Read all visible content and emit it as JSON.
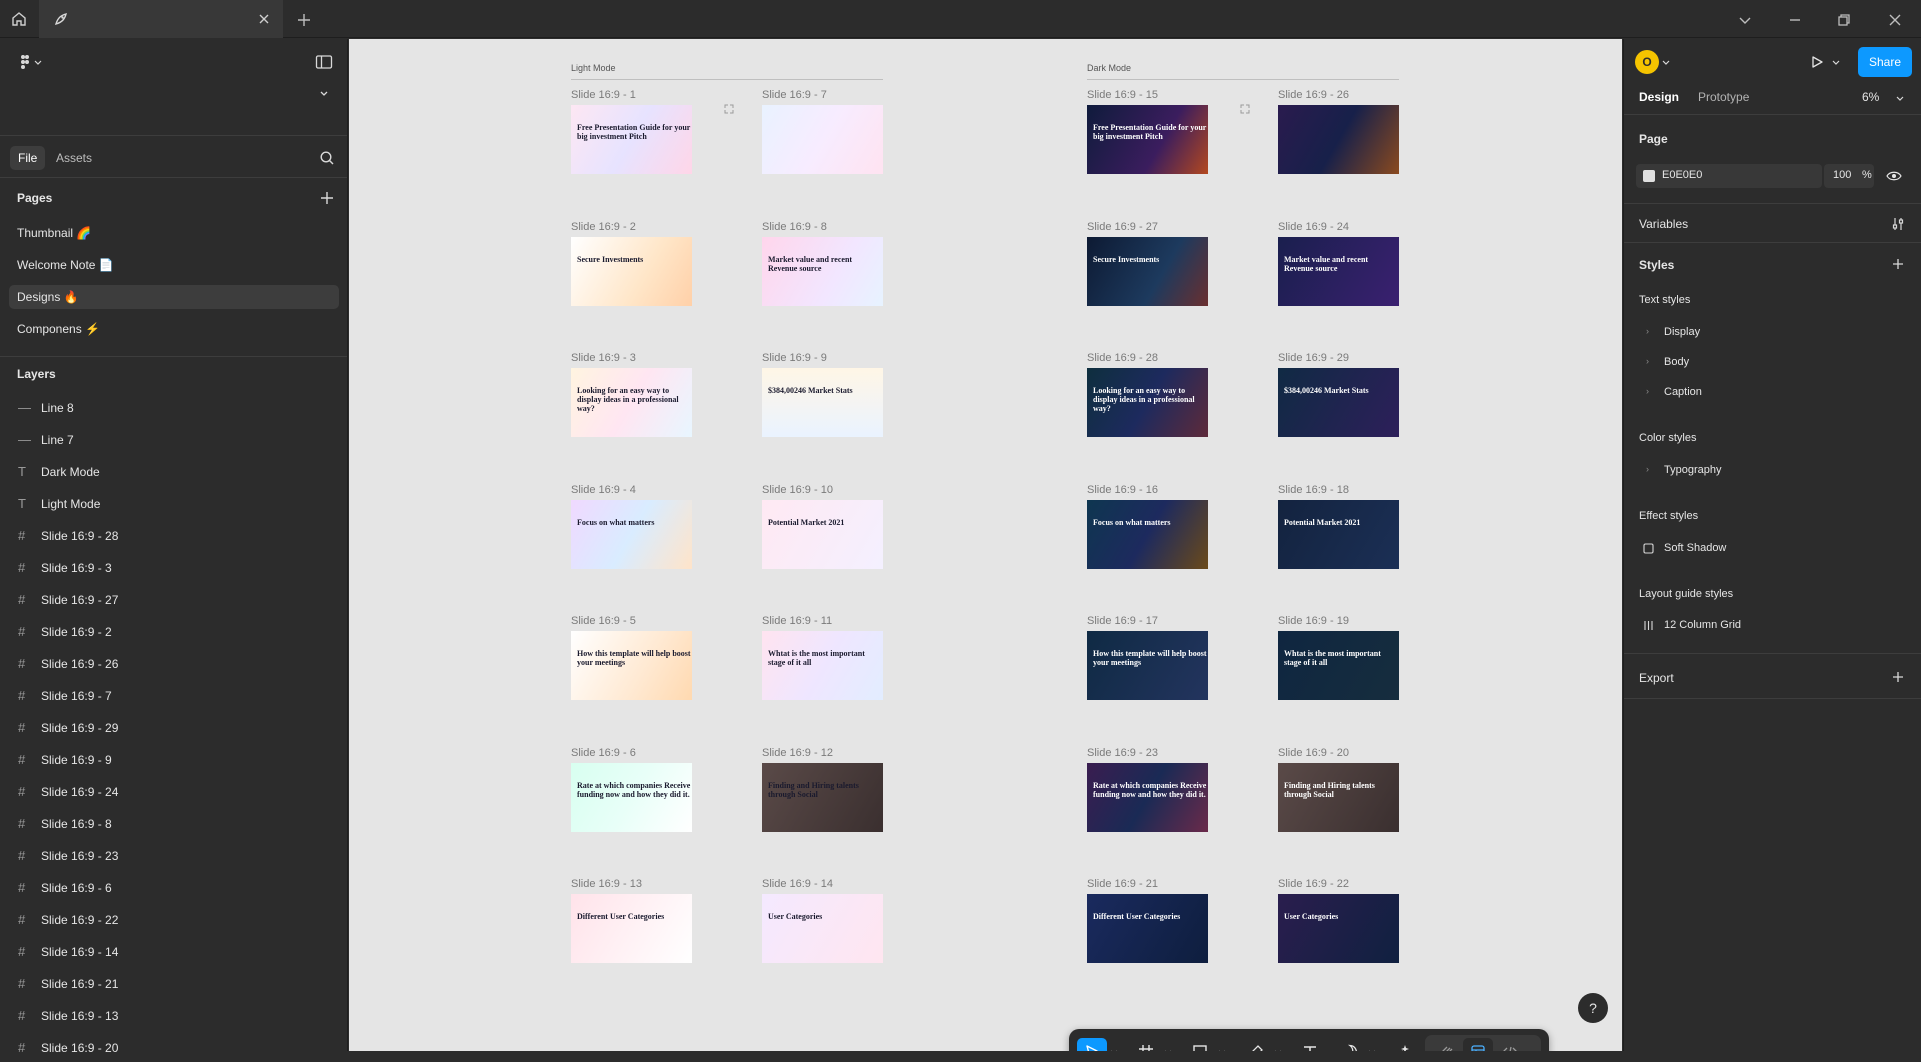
{
  "titlebar": {
    "tab_title": ""
  },
  "left": {
    "file_tab": "File",
    "assets_tab": "Assets",
    "pages_heading": "Pages",
    "pages": [
      {
        "label": "Thumbnail 🌈"
      },
      {
        "label": "Welcome Note 📄"
      },
      {
        "label": "Designs 🔥"
      },
      {
        "label": "Componens ⚡"
      }
    ],
    "layers_heading": "Layers",
    "layers": [
      {
        "label": "Line 8",
        "type": "line"
      },
      {
        "label": "Line 7",
        "type": "line"
      },
      {
        "label": "Dark Mode",
        "type": "text"
      },
      {
        "label": "Light Mode",
        "type": "text"
      },
      {
        "label": "Slide 16:9 - 28",
        "type": "frame"
      },
      {
        "label": "Slide 16:9 - 3",
        "type": "frame"
      },
      {
        "label": "Slide 16:9 - 27",
        "type": "frame"
      },
      {
        "label": "Slide 16:9 - 2",
        "type": "frame"
      },
      {
        "label": "Slide 16:9 - 26",
        "type": "frame"
      },
      {
        "label": "Slide 16:9 - 7",
        "type": "frame"
      },
      {
        "label": "Slide 16:9 - 29",
        "type": "frame"
      },
      {
        "label": "Slide 16:9 - 9",
        "type": "frame"
      },
      {
        "label": "Slide 16:9 - 24",
        "type": "frame"
      },
      {
        "label": "Slide 16:9 - 8",
        "type": "frame"
      },
      {
        "label": "Slide 16:9 - 23",
        "type": "frame"
      },
      {
        "label": "Slide 16:9 - 6",
        "type": "frame"
      },
      {
        "label": "Slide 16:9 - 22",
        "type": "frame"
      },
      {
        "label": "Slide 16:9 - 14",
        "type": "frame"
      },
      {
        "label": "Slide 16:9 - 21",
        "type": "frame"
      },
      {
        "label": "Slide 16:9 - 13",
        "type": "frame"
      },
      {
        "label": "Slide 16:9 - 20",
        "type": "frame"
      }
    ]
  },
  "canvas": {
    "light_heading": "Light Mode",
    "dark_heading": "Dark Mode",
    "light_slides": [
      {
        "label": "Slide 16:9 - 1",
        "title": "Free Presentation Guide for your big investment Pitch",
        "bg": "linear-gradient(120deg,#fde7f3,#e7e3ff 50%,#ffd6e8)"
      },
      {
        "label": "Slide 16:9 - 7",
        "title": "",
        "bg": "linear-gradient(120deg,#e9f2ff,#f7ecff 50%,#ffe3f1)"
      },
      {
        "label": "Slide 16:9 - 2",
        "title": "Secure Investments",
        "bg": "linear-gradient(120deg,#fff,#ffe6c8 60%,#ffd0a8)"
      },
      {
        "label": "Slide 16:9 - 8",
        "title": "Market value and recent Revenue source",
        "bg": "linear-gradient(120deg,#ffd6ec,#f2e6ff 60%,#e7f3ff)"
      },
      {
        "label": "Slide 16:9 - 3",
        "title": "Looking for an easy way to display ideas in a professional way?",
        "bg": "linear-gradient(120deg,#fff4e0,#ffe6f2 50%,#e8f6ff)"
      },
      {
        "label": "Slide 16:9 - 9",
        "title": "$384,00246   Market Stats",
        "bg": "linear-gradient(180deg,#fff6e6,#eaf3ff)"
      },
      {
        "label": "Slide 16:9 - 4",
        "title": "Focus on what matters",
        "bg": "linear-gradient(120deg,#f0d9ff,#d9ecff 50%,#ffe4c9)"
      },
      {
        "label": "Slide 16:9 - 10",
        "title": "Potential Market 2021",
        "bg": "linear-gradient(120deg,#ffe9f3,#f4f0ff)"
      },
      {
        "label": "Slide 16:9 - 5",
        "title": "How this template will help boost your meetings",
        "bg": "linear-gradient(120deg,#fff,#ffe9d2 60%,#ffd9b0)"
      },
      {
        "label": "Slide 16:9 - 11",
        "title": "Whtat is the most important stage of it all",
        "bg": "linear-gradient(120deg,#ffe4f0,#efe6ff 50%,#e2edff)"
      },
      {
        "label": "Slide 16:9 - 6",
        "title": "Rate at which companies Receive funding now and how they did it.",
        "bg": "linear-gradient(120deg,#d8fff0,#e8fff8 50%,#fff)"
      },
      {
        "label": "Slide 16:9 - 12",
        "title": "Finding and Hiring talents through Social",
        "bg": "linear-gradient(120deg,#5a4a48,#3a2f2f)"
      },
      {
        "label": "Slide 16:9 - 13",
        "title": "Different User Categories",
        "bg": "linear-gradient(120deg,#ffe3ea,#fff)"
      },
      {
        "label": "Slide 16:9 - 14",
        "title": "User Categories",
        "bg": "linear-gradient(120deg,#f4e9ff,#ffe6f0)"
      }
    ],
    "dark_slides": [
      {
        "label": "Slide 16:9 - 15",
        "title": "Free Presentation Guide for your big investment Pitch",
        "bg": "linear-gradient(120deg,#0f1b3c,#3b1d5e 60%,#b3481f)"
      },
      {
        "label": "Slide 16:9 - 26",
        "title": "",
        "bg": "linear-gradient(120deg,#2a1b4e,#17204a 50%,#8a4a1f)"
      },
      {
        "label": "Slide 16:9 - 27",
        "title": "Secure Investments",
        "bg": "linear-gradient(120deg,#0d1a33,#1d3a5e 60%,#6a2f2f)"
      },
      {
        "label": "Slide 16:9 - 24",
        "title": "Market value and recent Revenue source",
        "bg": "linear-gradient(120deg,#1a1f4e,#3a2070)"
      },
      {
        "label": "Slide 16:9 - 28",
        "title": "Looking for an easy way to display ideas in a professional way?",
        "bg": "linear-gradient(120deg,#0e2f3e,#1d2a5e 50%,#5e2a3a)"
      },
      {
        "label": "Slide 16:9 - 29",
        "title": "$384,00246   Market Stats",
        "bg": "linear-gradient(120deg,#102a44,#2d1f5a)"
      },
      {
        "label": "Slide 16:9 - 16",
        "title": "Focus on what matters",
        "bg": "linear-gradient(120deg,#0e3650,#1d2a5e 50%,#6b4a1a)"
      },
      {
        "label": "Slide 16:9 - 18",
        "title": "Potential Market 2021",
        "bg": "linear-gradient(120deg,#13233f,#1b2f55)"
      },
      {
        "label": "Slide 16:9 - 17",
        "title": "How this template will help boost your meetings",
        "bg": "linear-gradient(120deg,#0f2a44,#23345e)"
      },
      {
        "label": "Slide 16:9 - 19",
        "title": "Whtat is the most important stage of it all",
        "bg": "linear-gradient(120deg,#0f2640,#162d3e)"
      },
      {
        "label": "Slide 16:9 - 23",
        "title": "Rate at which companies Receive funding now and how they did it.",
        "bg": "linear-gradient(120deg,#3a1d50,#1a2a55 50%,#6a2a4a)"
      },
      {
        "label": "Slide 16:9 - 20",
        "title": "Finding and Hiring talents through Social",
        "bg": "linear-gradient(120deg,#5a4a48,#3a2f2f)"
      },
      {
        "label": "Slide 16:9 - 21",
        "title": "Different User Categories",
        "bg": "linear-gradient(120deg,#1a2a5e,#0e1e3e)"
      },
      {
        "label": "Slide 16:9 - 22",
        "title": "User Categories",
        "bg": "linear-gradient(120deg,#2a1e4e,#102040)"
      }
    ]
  },
  "right": {
    "avatar_initial": "O",
    "share_label": "Share",
    "design_tab": "Design",
    "prototype_tab": "Prototype",
    "zoom": "6%",
    "page_heading": "Page",
    "page_color_hex": "E0E0E0",
    "page_opacity": "100",
    "percent": "%",
    "variables_heading": "Variables",
    "styles_heading": "Styles",
    "text_styles_heading": "Text styles",
    "text_styles": [
      "Display",
      "Body",
      "Caption"
    ],
    "color_styles_heading": "Color styles",
    "color_styles": [
      "Typography"
    ],
    "effect_styles_heading": "Effect styles",
    "effect_styles": [
      "Soft Shadow"
    ],
    "layout_guide_heading": "Layout guide styles",
    "layout_guides": [
      "12 Column Grid"
    ],
    "export_heading": "Export"
  },
  "colors": {
    "accent": "#0d99ff",
    "avatar": "#f5c400",
    "canvas": "#e5e5e5",
    "panel": "#2c2c2c"
  }
}
